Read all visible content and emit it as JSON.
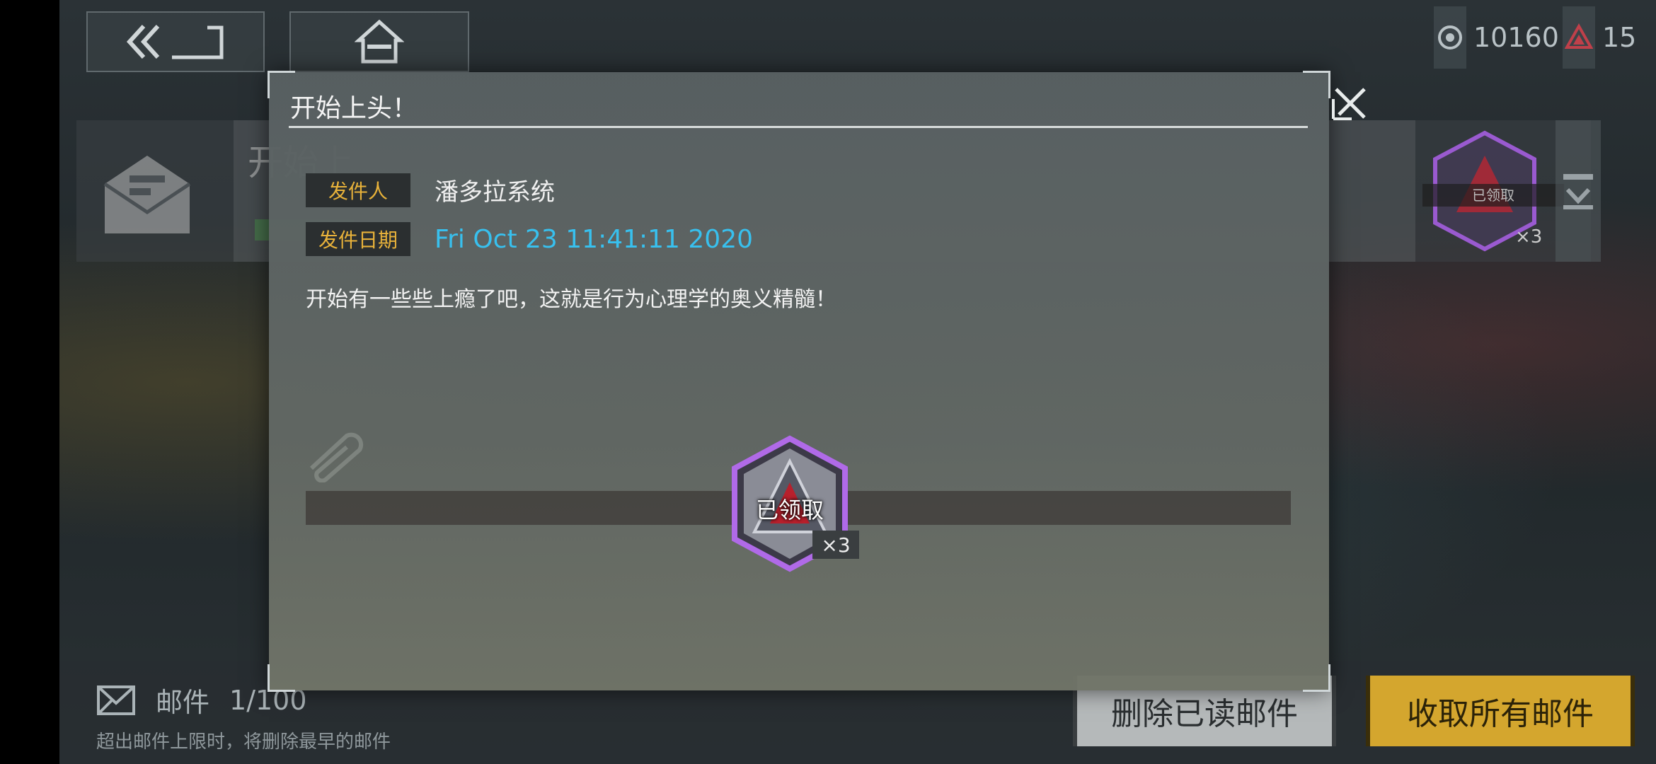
{
  "nav": {
    "back_icon": "double-chevron-back-icon",
    "home_icon": "home-icon"
  },
  "currency": {
    "primary_icon": "eye-token-icon",
    "primary_value": "10160",
    "secondary_icon": "red-triangle-crystal-icon",
    "secondary_value": "15",
    "secondary_color": "#c0404a"
  },
  "background_mail": {
    "title": "开始上",
    "reward_status": "已领取",
    "reward_qty": "×3"
  },
  "mailbox": {
    "label": "邮件",
    "count": "1/100",
    "note": "超出邮件上限时，将删除最早的邮件",
    "delete_read_label": "删除已读邮件",
    "collect_all_label": "收取所有邮件",
    "collect_color": "#d4a62e"
  },
  "dialog": {
    "title": "开始上头！",
    "sender_label": "发件人",
    "sender": "潘多拉系统",
    "date_label": "发件日期",
    "date": "Fri Oct 23 11:41:11 2020",
    "body": "开始有一些些上瘾了吧，这就是行为心理学的奥义精髓！",
    "reward": {
      "status": "已领取",
      "quantity": "×3"
    }
  }
}
